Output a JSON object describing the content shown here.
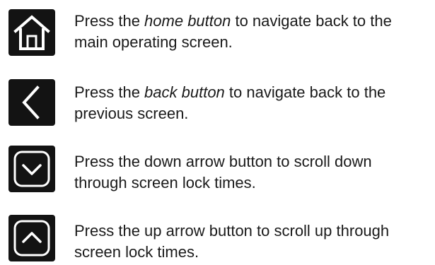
{
  "instructions": [
    {
      "icon": "home-icon",
      "text_before": "Press the ",
      "emphasis": "home button",
      "text_after": " to navigate back to the main operating screen."
    },
    {
      "icon": "back-chevron-icon",
      "text_before": "Press the ",
      "emphasis": "back button",
      "text_after": " to navigate back to the previous screen."
    },
    {
      "icon": "down-arrow-icon",
      "text": "Press the down arrow button to scroll down through screen lock times."
    },
    {
      "icon": "up-arrow-icon",
      "text": "Press the up arrow button to scroll up through screen lock times."
    }
  ],
  "colors": {
    "icon_background": "#131313",
    "icon_foreground": "#ffffff",
    "text": "#1a1a1a"
  }
}
